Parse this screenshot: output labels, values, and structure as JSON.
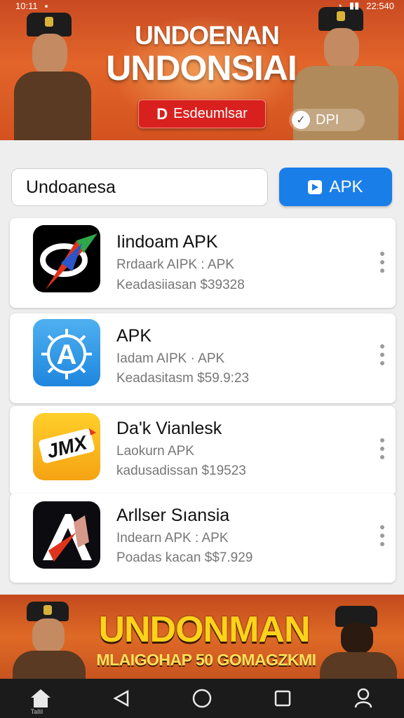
{
  "status_bar": {
    "time_left": "10:11",
    "time_right": "22:540"
  },
  "top_banner": {
    "title_line1": "UNDOENAN",
    "title_line2": "UNDONSIAI",
    "cta_label": "Esdeumlsar",
    "chip_label": "DPI"
  },
  "search": {
    "value": "Undoanesa",
    "button_label": "APK"
  },
  "apps": [
    {
      "title": "Iindoam APK",
      "subtitle": "Rrdaark AIPK : APK",
      "meta": "Keadasiiasan $39328"
    },
    {
      "title": "APK",
      "subtitle": "Iadam AIPK · APK",
      "meta": "Keadasitasm $59.9:23"
    },
    {
      "title": "Da'k Vianlesk",
      "subtitle": "Laokurn APK",
      "meta": "kadusadissan $19523"
    },
    {
      "title": "Arllser Sıansia",
      "subtitle": "Indearn APK : APK",
      "meta": "Poadas kacan $$7.929"
    }
  ],
  "bottom_banner": {
    "title": "UNDONMAN",
    "subtitle": "MLAIGOHAP 50 GOMAGZKMI"
  },
  "navbar": {
    "home_label": "Tallil"
  },
  "colors": {
    "accent_blue": "#1a7ee8",
    "banner_orange": "#e2652a",
    "cta_red": "#d8211f"
  }
}
